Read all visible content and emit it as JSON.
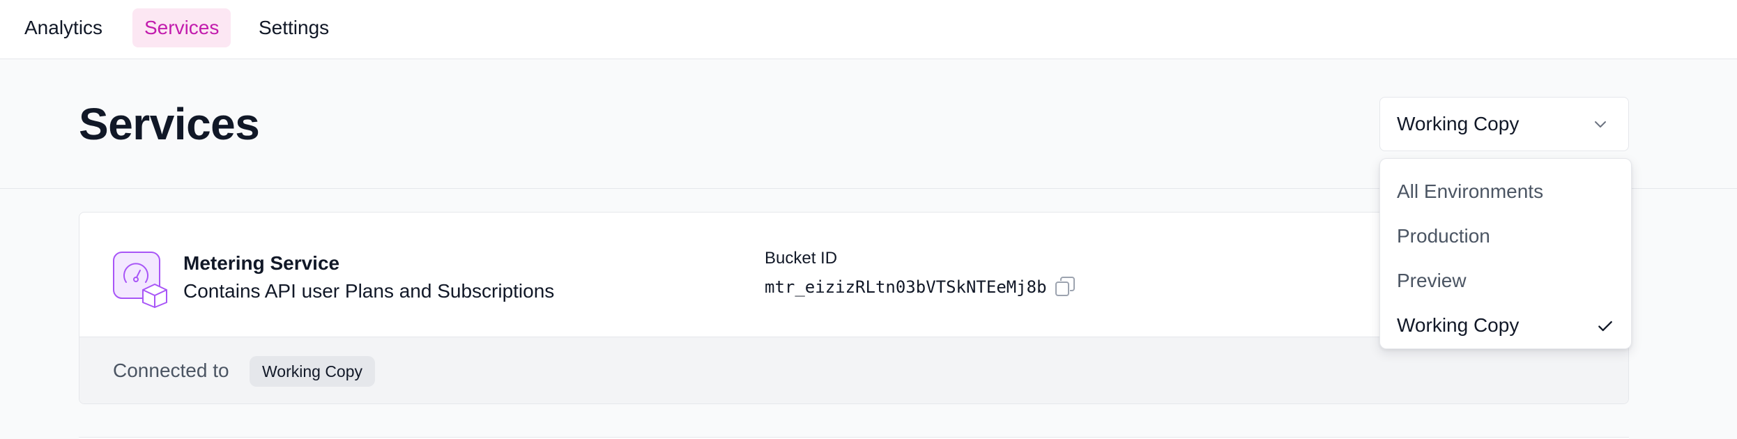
{
  "nav": {
    "tabs": [
      {
        "label": "Analytics",
        "active": false
      },
      {
        "label": "Services",
        "active": true
      },
      {
        "label": "Settings",
        "active": false
      }
    ]
  },
  "header": {
    "title": "Services",
    "environment_select": {
      "value": "Working Copy",
      "icon": "chevron-down-icon"
    }
  },
  "service_card": {
    "icon": "metering-gauge-icon",
    "name": "Metering Service",
    "description": "Contains API user Plans and Subscriptions",
    "bucket_label": "Bucket ID",
    "bucket_id": "mtr_eizizRLtn03bVTSkNTEeMj8b",
    "copy_icon": "copy-icon",
    "footer": {
      "connected_label": "Connected to",
      "environment_badge": "Working Copy"
    }
  },
  "environment_menu": {
    "options": [
      {
        "label": "All Environments",
        "selected": false
      },
      {
        "label": "Production",
        "selected": false
      },
      {
        "label": "Preview",
        "selected": false
      },
      {
        "label": "Working Copy",
        "selected": true
      }
    ],
    "check_icon": "check-icon"
  },
  "colors": {
    "accent": "#c21cad",
    "accent_bg": "#fce7f3",
    "icon_purple": "#a855f7",
    "icon_purple_bg": "#f3e8ff"
  }
}
